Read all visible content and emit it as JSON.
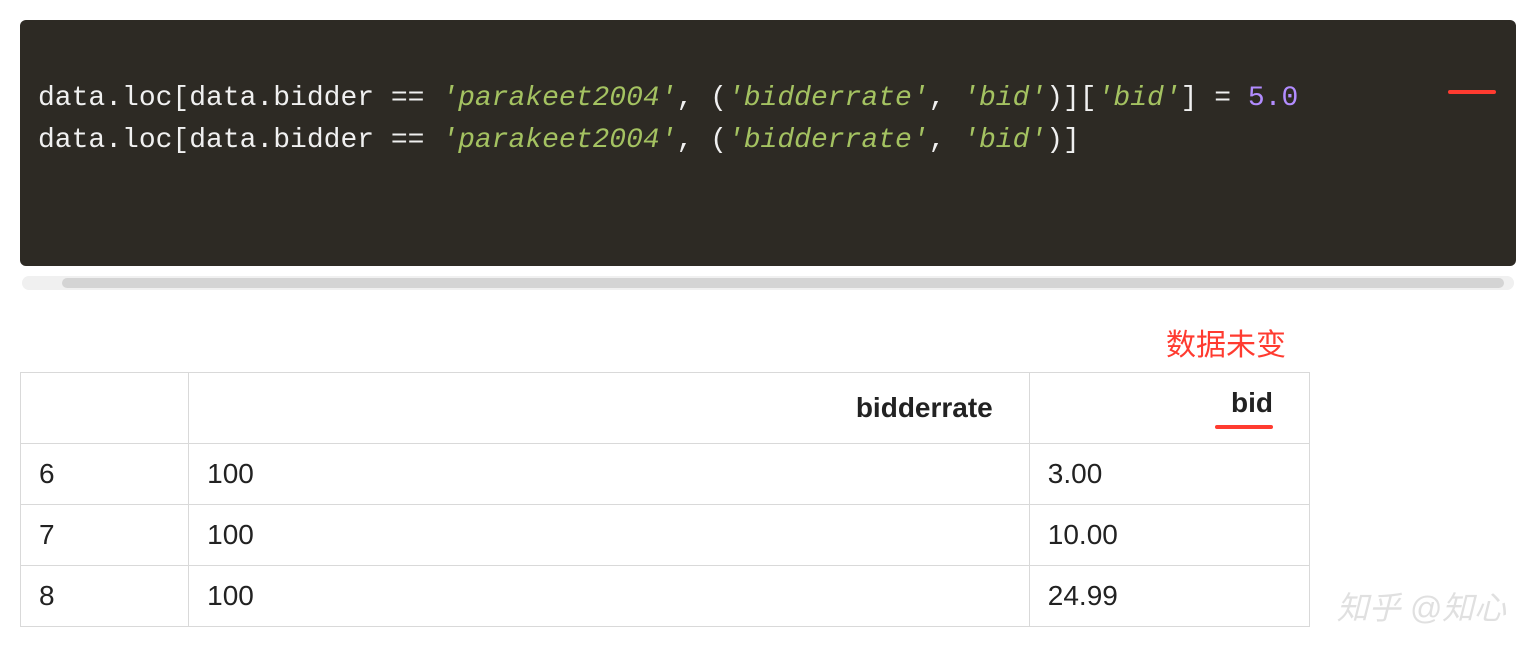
{
  "code": {
    "line1": {
      "p1": "data.loc[data.bidder == ",
      "s1": "'parakeet2004'",
      "p2": ", (",
      "s2": "'bidderrate'",
      "p3": ", ",
      "s3": "'bid'",
      "p4": ")][",
      "s4": "'bid'",
      "p5": "] = ",
      "n1": "5.0"
    },
    "line2": {
      "p1": "data.loc[data.bidder == ",
      "s1": "'parakeet2004'",
      "p2": ", (",
      "s2": "'bidderrate'",
      "p3": ", ",
      "s3": "'bid'",
      "p4": ")]"
    }
  },
  "annotation": "数据未变",
  "table": {
    "headers": {
      "index": "",
      "bidderrate": "bidderrate",
      "bid": "bid"
    },
    "rows": [
      {
        "index": "6",
        "bidderrate": "100",
        "bid": "3.00"
      },
      {
        "index": "7",
        "bidderrate": "100",
        "bid": "10.00"
      },
      {
        "index": "8",
        "bidderrate": "100",
        "bid": "24.99"
      }
    ]
  },
  "watermark": "知乎 @知心",
  "colors": {
    "annotation_red": "#ff3b30",
    "code_bg": "#2d2a24",
    "code_string": "#a4c261",
    "code_number": "#b28cff"
  }
}
